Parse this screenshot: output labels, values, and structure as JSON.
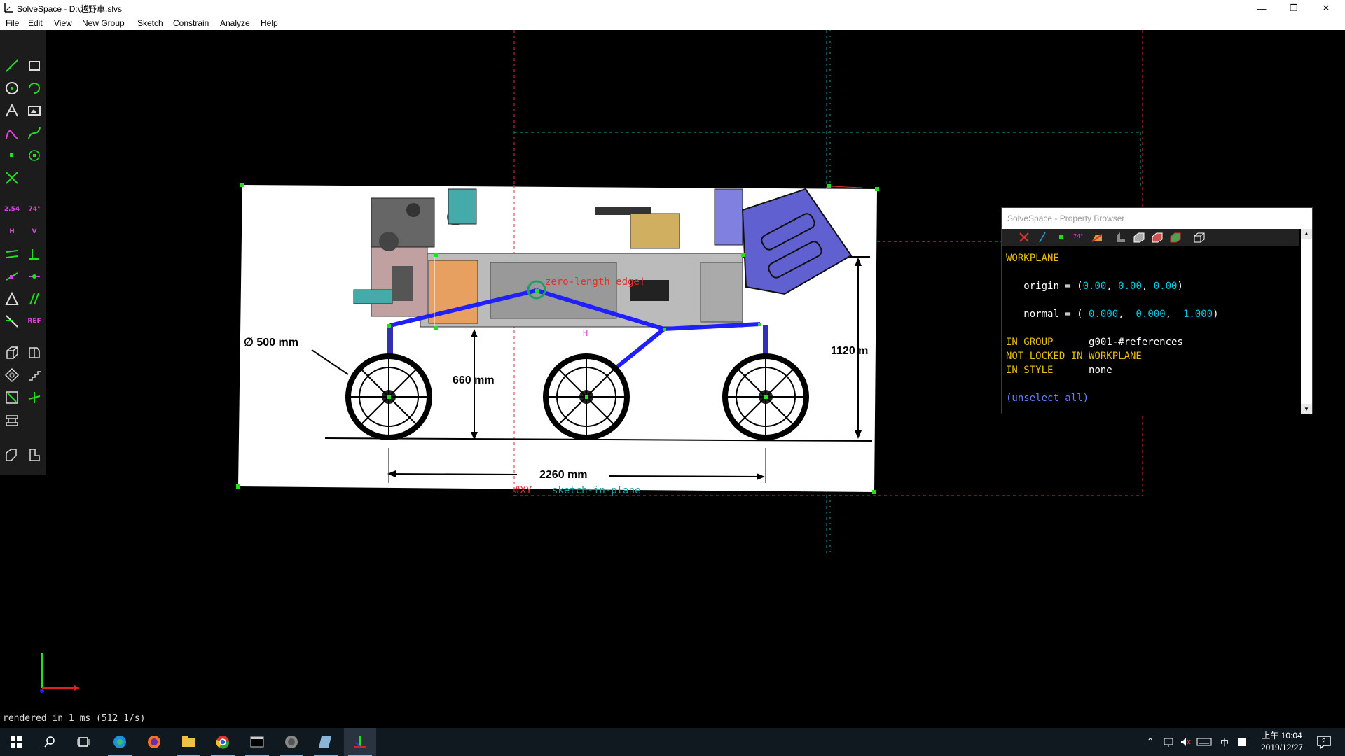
{
  "window": {
    "title": "SolveSpace - D:\\越野車.slvs",
    "minimize": "—",
    "maximize": "❐",
    "close": "✕"
  },
  "menu": [
    "File",
    "Edit",
    "View",
    "New Group",
    "Sketch",
    "Constrain",
    "Analyze",
    "Help"
  ],
  "toolbar": {
    "tools": [
      "line-segment",
      "rectangle",
      "circle",
      "arc",
      "text",
      "image",
      "tangent-arc",
      "bezier-spline",
      "point",
      "construction-point",
      "split-curves",
      "distance-dimension",
      "angle-dimension",
      "horizontal",
      "vertical",
      "parallel",
      "perpendicular",
      "point-on-line",
      "midpoint",
      "symmetric",
      "equal-length",
      "other-constraint",
      "reference",
      "extrude",
      "lathe",
      "step-rotate",
      "step-translate",
      "in-workplane",
      "3d-mode",
      "workplane-new",
      "assemble",
      "new-sketch"
    ],
    "dimension_label": "2.54",
    "angle_label": "74°",
    "ref_label": "REF",
    "h_label": "H",
    "v_label": "V"
  },
  "drawing": {
    "diameter_label": "∅ 500 mm",
    "height_660": "660 mm",
    "height_1120": "1120 m",
    "length_2260": "2260 mm",
    "zero_length_edge": "zero-length edge!",
    "workplane_label": "#XY",
    "sketch_plane_label": "sketch-in-plane",
    "h_marker": "H"
  },
  "property_browser": {
    "title": "SolveSpace - Property Browser",
    "section": "WORKPLANE",
    "origin_label": "origin = (",
    "origin_values": [
      "0.00",
      "0.00",
      "0.00"
    ],
    "normal_label": "normal = (",
    "normal_values": [
      "0.000",
      "0.000",
      "1.000"
    ],
    "in_group_label": "IN GROUP",
    "in_group_value": "g001-#references",
    "not_locked": "NOT LOCKED IN WORKPLANE",
    "in_style_label": "IN STYLE",
    "in_style_value": "none",
    "unselect": "(unselect all)"
  },
  "status": "rendered in 1 ms (512 1/s)",
  "taskbar": {
    "apps": [
      "start",
      "search",
      "task-view",
      "edge",
      "firefox",
      "file-explorer",
      "chrome",
      "terminal",
      "media",
      "notes",
      "solvespace"
    ],
    "tray_ime": "中",
    "clock_time": "上午 10:04",
    "clock_date": "2019/12/27",
    "notification_count": "2"
  },
  "colors": {
    "toolbar_bg": "#1c1c1c",
    "workplane_dash": "#e03030",
    "construction_dash": "#20a0a0",
    "highlight": "#2020ff",
    "accent_yellow": "#e8c000",
    "accent_cyan": "#00c8e0"
  }
}
